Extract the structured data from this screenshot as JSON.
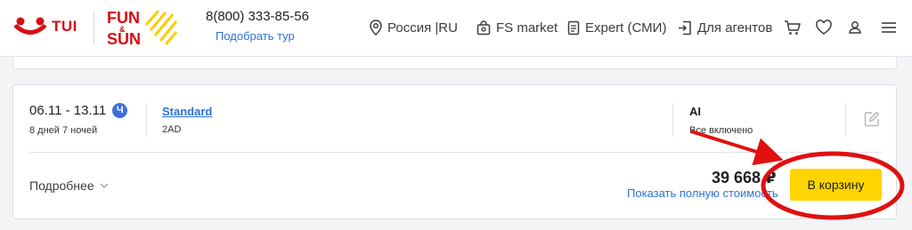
{
  "header": {
    "brand_tui": "TUI",
    "brand_funsun_top": "FUN",
    "brand_funsun_amp": "&",
    "brand_funsun_bottom": "SUN",
    "phone": "8(800) 333-85-56",
    "pick_tour": "Подобрать тур",
    "nav": {
      "region": "Россия |RU",
      "fs_market": "FS market",
      "expert": "Expert (СМИ)",
      "agents": "Для агентов"
    },
    "icons": [
      "map-pin-icon",
      "shopping-bag-icon",
      "document-icon",
      "agent-door-icon",
      "cart-icon",
      "heart-icon",
      "user-icon",
      "menu-icon"
    ]
  },
  "card": {
    "dates": "06.11 - 13.11",
    "badge": "Ч",
    "nights": "8 дней 7 ночей",
    "room_type": "Standard",
    "room_code": "2AD",
    "meal_code": "AI",
    "meal_desc": "Все включено",
    "more_label": "Подробнее",
    "price": "39 668 ₽",
    "full_cost_link": "Показать полную стоимость",
    "cart_button": "В корзину"
  },
  "colors": {
    "brand_red": "#d40e14",
    "brand_yellow": "#ffd400",
    "link_blue": "#2d72d9",
    "badge_blue": "#3d6fd9",
    "annotation_red": "#e01010"
  }
}
